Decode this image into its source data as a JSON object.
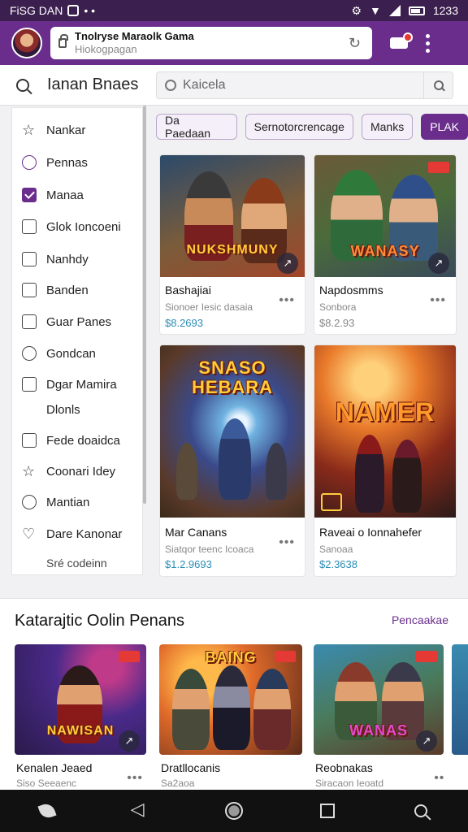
{
  "status": {
    "left_text": "FiSG DAN",
    "time": "1233"
  },
  "header": {
    "url_title": "Tnolryse Maraolk Gama",
    "url_sub": "Hiokogpagan"
  },
  "search": {
    "title": "Ianan Bnaes",
    "placeholder": "Kaicela"
  },
  "sidebar": {
    "items": [
      {
        "label": "Nankar",
        "icon": "star-outline-icon"
      },
      {
        "label": "Pennas",
        "icon": "badge-icon"
      },
      {
        "label": "Manaa",
        "icon": "checkbox-checked-icon"
      },
      {
        "label": "Glok Ioncoeni",
        "icon": "chart-icon"
      },
      {
        "label": "Nanhdy",
        "icon": "card-icon"
      },
      {
        "label": "Banden",
        "icon": "square-icon"
      },
      {
        "label": "Guar Panes",
        "icon": "image-icon"
      },
      {
        "label": "Gondcan",
        "icon": "leaf-icon"
      },
      {
        "label": "Dgar Mamira",
        "icon": "camera-icon"
      },
      {
        "label": "Dlonls",
        "icon": ""
      },
      {
        "label": "Fede doaidca",
        "icon": "doc-icon"
      },
      {
        "label": "Coonari Idey",
        "icon": "star-icon"
      },
      {
        "label": "Mantian",
        "icon": "clock-icon"
      },
      {
        "label": "Dare Kanonar",
        "icon": "heart-icon"
      },
      {
        "label": "Sré codeinn",
        "icon": ""
      }
    ]
  },
  "chips": [
    "Da Paedaan",
    "Sernotorcrencage",
    "Manks",
    "PLAK"
  ],
  "grid": [
    {
      "art_title": "NUKSHMUNY",
      "name": "Bashajiai",
      "sub": "Sionoer Iesic dasaia",
      "price": "$8.2693"
    },
    {
      "art_title": "WANASY",
      "name": "Napdosmms",
      "sub": "Sonbora",
      "price": "$8.2.93"
    },
    {
      "art_title": "SNASO HEBARA",
      "name": "Mar Canans",
      "sub": "Siatqor teenc Icoaca",
      "price": "$1.2.9693"
    },
    {
      "art_title": "NAMER",
      "name": "Raveai o Ionnahefer",
      "sub": "Sanoaa",
      "price": "$2.3638"
    }
  ],
  "section2": {
    "title": "Katarajtic Oolin Penans",
    "link": "Pencaakae",
    "cards": [
      {
        "art_title": "NAWISAN",
        "name": "Kenalen Jeaed",
        "sub": "Siso Seeaenc"
      },
      {
        "art_title": "BAING",
        "name": "Dratllocanis",
        "sub": "Sa2aoa"
      },
      {
        "art_title": "WANAS",
        "name": "Reobnakas",
        "sub": "Siracaon Ieoatd"
      }
    ]
  },
  "colors": {
    "brand": "#6a2d8c",
    "price": "#2a8db5",
    "badge": "#e53935"
  }
}
